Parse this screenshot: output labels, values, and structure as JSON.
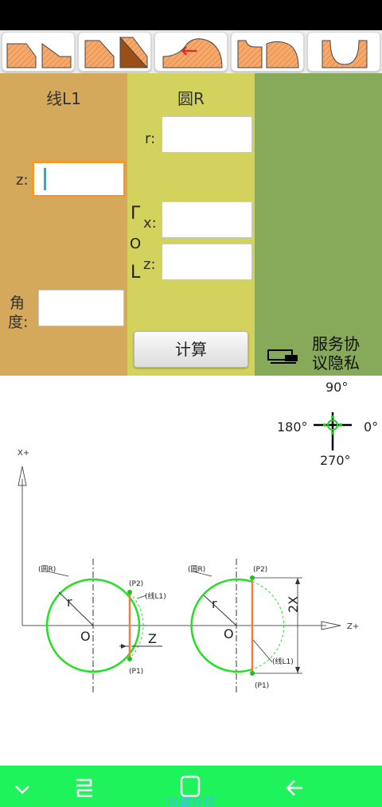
{
  "toolbar": {
    "buttons": [
      {
        "name": "profile-line-chamfer-button",
        "icon": "chamfer-profile-icon"
      },
      {
        "name": "profile-line-taper-button",
        "icon": "taper-profile-icon"
      },
      {
        "name": "profile-back-arc-button",
        "icon": "back-arrow-icon",
        "arrow": "←"
      },
      {
        "name": "profile-step-arc-button",
        "icon": "step-arc-profile-icon"
      },
      {
        "name": "profile-groove-button",
        "icon": "groove-profile-icon"
      }
    ]
  },
  "line_panel": {
    "title": "线L1",
    "z_label": "z:",
    "z_value": "",
    "angle_label_line1": "角",
    "angle_label_line2": "度:",
    "angle_value": ""
  },
  "circle_panel": {
    "title": "圆R",
    "r_label": "r:",
    "r_value": "",
    "center_bracket_top": "Γ",
    "center_bracket_mid": "O",
    "center_bracket_bottom": "L",
    "x_label": "x:",
    "x_value": "",
    "z_label": "z:",
    "z_value": "",
    "calc_label": "计算"
  },
  "service": {
    "text": "服务协议隐私"
  },
  "compass": {
    "top": "90°",
    "left": "180°",
    "right": "0°",
    "bottom": "270°"
  },
  "diagram": {
    "x_axis_label": "X+",
    "z_axis_label": "Z+",
    "circle_label": "(圆R)",
    "line_label": "(线L1)",
    "p1": "(P1)",
    "p2": "(P2)",
    "r_label": "r",
    "origin_label": "O",
    "z_label": "Z",
    "two_x_label": "2X"
  },
  "watermark": "流量社区",
  "colors": {
    "panel_line": "#d5a95b",
    "panel_circle": "#d2d25c",
    "panel_service": "#86aa5a",
    "focus": "#f39a2d",
    "circle_green": "#22e022",
    "line_orange": "#ef7f40",
    "navbar": "#1ef35c"
  }
}
